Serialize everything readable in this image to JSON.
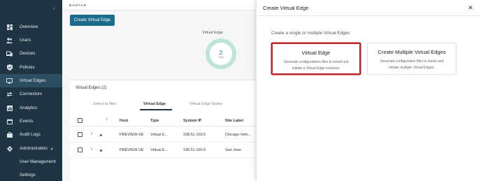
{
  "sidebar": {
    "collapse_icon": "chevron-left-icon",
    "items": [
      {
        "label": "Overview",
        "icon": "dashboard-icon"
      },
      {
        "label": "Users",
        "icon": "users-icon"
      },
      {
        "label": "Devices",
        "icon": "devices-icon"
      },
      {
        "label": "Policies",
        "icon": "shield-icon"
      },
      {
        "label": "Virtual Edges",
        "icon": "monitor-icon",
        "active": true
      },
      {
        "label": "Connectors",
        "icon": "arrows-icon"
      },
      {
        "label": "Analytics",
        "icon": "chart-icon"
      },
      {
        "label": "Events",
        "icon": "calendar-icon"
      },
      {
        "label": "Audit Logs",
        "icon": "briefcase-icon"
      },
      {
        "label": "Administration",
        "icon": "gear-icon",
        "expanded": true
      },
      {
        "label": "User Management"
      },
      {
        "label": "Settings"
      }
    ]
  },
  "main": {
    "logo_text": "BANYAN",
    "create_button": "Create Virtual Edge",
    "stat": {
      "title": "Virtual Edge",
      "count": "2",
      "count_label": "Total"
    },
    "panel": {
      "title": "Virtual Edges (2)",
      "filter_label": "Select to filter:",
      "tabs": [
        "Virtual Edge",
        "Virtual Edge Nodes"
      ],
      "columns": [
        "Host",
        "Type",
        "System IP",
        "Site Label"
      ],
      "rows": [
        {
          "host": "PREVIEW-VE",
          "type": "Virtual E...",
          "ip": "198.51.100.5",
          "site": "Chicago-Vehi..."
        },
        {
          "host": "PREVIEW-VE",
          "type": "Virtual E...",
          "ip": "198.51.100.6",
          "site": "San Jose"
        }
      ]
    }
  },
  "modal": {
    "title": "Create Virtual Edge",
    "close_icon": "close-icon",
    "subtitle": "Create a single or multiple Virtual Edges",
    "cards": [
      {
        "title": "Virtual Edge",
        "desc": "Generate configurations files to install and initiate a Virtual Edge instance.",
        "selected": true
      },
      {
        "title": "Create Multiple Virtual Edges",
        "desc": "Generate configuration files to install and initiate multiple Virtual Edges.",
        "selected": false
      }
    ]
  },
  "colors": {
    "sidebar_bg": "#1f3543",
    "accent": "#1c6b8c",
    "selected_border": "#b8262e"
  }
}
